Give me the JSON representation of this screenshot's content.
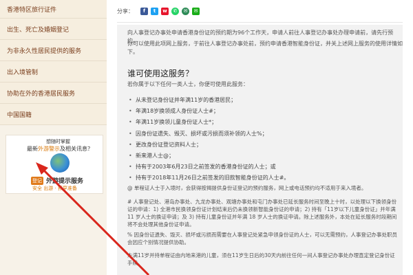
{
  "sidebar": {
    "items": [
      {
        "label": "香港特区旅行证件"
      },
      {
        "label": "出生、死亡及婚姻登记"
      },
      {
        "label": "为非永久性居民提供的服务"
      },
      {
        "label": "出入境管制"
      },
      {
        "label": "协助在外的香港居民服务"
      },
      {
        "label": "中国国籍"
      }
    ]
  },
  "ad": {
    "line1": "想随时掌握",
    "line2_a": "最新",
    "line2_b": "外游警示",
    "line2_c": "及相关讯息？",
    "badge": "登记",
    "line3": "外游提示服务",
    "line4": "安全 出游 · 预早准备"
  },
  "share": {
    "label": "分享：",
    "icons": [
      {
        "name": "facebook-icon",
        "glyph": "f",
        "color": "#3b5998"
      },
      {
        "name": "twitter-icon",
        "glyph": "t",
        "color": "#1da1f2"
      },
      {
        "name": "weibo-icon",
        "glyph": "w",
        "color": "#e6162d"
      },
      {
        "name": "whatsapp-icon",
        "glyph": "✆",
        "color": "#25d366"
      },
      {
        "name": "email-icon",
        "glyph": "✉",
        "color": "#2e8b57"
      },
      {
        "name": "wechat-icon",
        "glyph": "✉",
        "color": "#1aad19"
      }
    ]
  },
  "content": {
    "intro1": "向人事登记办事处申请香港身份证的预约期为96个工作天，申请人前往人事登记办事处办理申请前，请先行预约。",
    "intro2a": "你可以使用此项网上服务，于前往人事登记办事处前，预约申请香港智能身份证，并关上述网上服务的使用详情如",
    "intro2b": "下。",
    "heading": "谁可使用这服务？",
    "subheading": "若你属于以下任何一类人士，你便可使用此服务：",
    "bullets": [
      "从未登记身份证并年满11岁的香港居民；",
      "年满18岁换领成人身份证人士#；",
      "年满11岁换领儿童身份证人士*；",
      "因身份证遗失、毁灭、损坏或污损而须补领的人士%；",
      "更改身份证登记资料人士；",
      "新来港人士@；",
      "持有于2003年6月23日之前签发的香港身份证的人士；或",
      "持有于2018年11月26日之前签发的旧款智能身份证的人士#。"
    ],
    "note1": "@ 单程证人士于入境时，会获得按揭提供身份证登记的预约服务，网上或电话预约均不适用于来入境者。",
    "note2": "# 人事登记处、港岛办事处、九龙办事处、观塘办事处和屯门办事处已延长服务时间至晚上十时，以处理以下换领身份证的申请：1) 全港市民换领身份证计划结束后仍未换领新智能身份证的申请；2) 持有「11岁以下儿童身份证」并年满 11 岁人士的换证申请；及 3) 持有儿童身份证并年满 18 岁人士的换证申请。除上述服务外，本处在延长服务时段期间将不会处理其他身份证申请。",
    "note3": "% 因身份证遗失、毁灭、损坏或污损而需要在人事登记处紧急申领身份证的人士，可以无需预约，人事登记办事处职员会因应个别情况提供协助。",
    "note4": "未满11岁并持单程证由内地来港的儿童，须在11岁生日后的30天内前往任何一间人事登记办事处办理直定登记身份证手续。"
  }
}
